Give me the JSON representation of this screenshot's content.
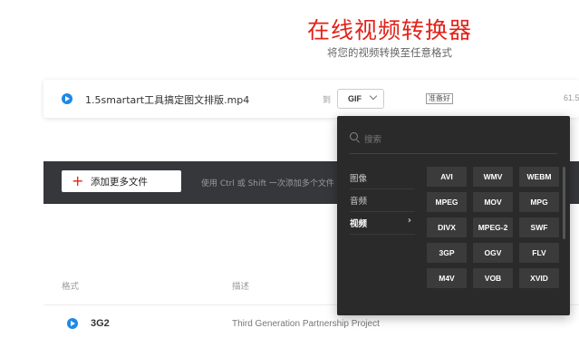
{
  "header": {
    "title": "在线视频转换器",
    "subtitle": "将您的视频转换至任意格式"
  },
  "file": {
    "name": "1.5smartart工具搞定图文排版.mp4",
    "to_label": "到",
    "selected_format": "GIF",
    "status": "准备好",
    "size": "61.5"
  },
  "toolbar": {
    "add_label": "添加更多文件",
    "hint": "使用 Ctrl 或 Shift 一次添加多个文件"
  },
  "table": {
    "headers": [
      "格式",
      "描述"
    ],
    "rows": [
      {
        "format": "3G2",
        "description": "Third Generation Partnership Project"
      }
    ]
  },
  "dropdown": {
    "search_placeholder": "搜索",
    "categories": [
      "图像",
      "音频",
      "视频"
    ],
    "active_category": "视频",
    "formats": [
      "AVI",
      "WMV",
      "WEBM",
      "MPEG",
      "MOV",
      "MPG",
      "DIVX",
      "MPEG-2",
      "SWF",
      "3GP",
      "OGV",
      "FLV",
      "M4V",
      "VOB",
      "XVID"
    ]
  },
  "colors": {
    "accent": "#e2231a",
    "dark_bar": "#35373a",
    "dropdown_bg": "#2a2a2b",
    "format_tile": "#3b3b3c",
    "file_icon": "#1e88e5"
  }
}
